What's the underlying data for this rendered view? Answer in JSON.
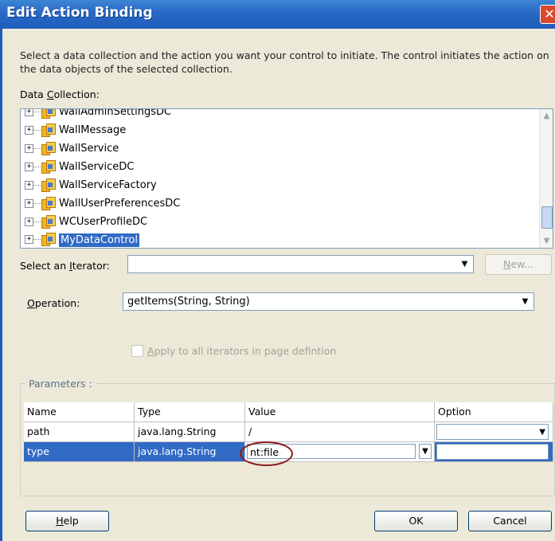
{
  "window": {
    "title": "Edit Action Binding",
    "close_glyph": "✕"
  },
  "description": "Select a data collection and the action you want your control to initiate. The control initiates the action on the data objects of the selected collection.",
  "data_collection": {
    "label_pre": "Data ",
    "label_mnemonic": "C",
    "label_post": "ollection:",
    "items": [
      {
        "label": "WallAdminSettingsDC",
        "expander": "+"
      },
      {
        "label": "WallMessage",
        "expander": "+"
      },
      {
        "label": "WallService",
        "expander": "+"
      },
      {
        "label": "WallServiceDC",
        "expander": "+"
      },
      {
        "label": "WallServiceFactory",
        "expander": "+"
      },
      {
        "label": "WallUserPreferencesDC",
        "expander": "+"
      },
      {
        "label": "WCUserProfileDC",
        "expander": "+"
      },
      {
        "label": "MyDataControl",
        "expander": "+",
        "selected": true
      }
    ]
  },
  "iterator": {
    "label_pre": "Select an ",
    "label_mnemonic": "I",
    "label_post": "terator:",
    "value": "",
    "new_button_mnemonic": "N",
    "new_button_rest": "ew..."
  },
  "operation": {
    "label_mnemonic": "O",
    "label_post": "peration:",
    "value": "getItems(String, String)"
  },
  "apply_all": {
    "label_mnemonic": "A",
    "label_post": "pply to all iterators in page defintion",
    "checked": false
  },
  "parameters": {
    "legend": "Parameters :",
    "columns": [
      "Name",
      "Type",
      "Value",
      "Option"
    ],
    "rows": [
      {
        "name": "path",
        "type": "java.lang.String",
        "value": "/",
        "option": ""
      },
      {
        "name": "type",
        "type": "java.lang.String",
        "value": "nt:file",
        "option": "",
        "selected": true
      }
    ]
  },
  "buttons": {
    "help_mnemonic": "H",
    "help_rest": "elp",
    "ok": "OK",
    "cancel": "Cancel"
  },
  "colors": {
    "title_bar": "#2a6ac7",
    "selection": "#316ac5",
    "highlight_ellipse": "#8b1d1d"
  }
}
